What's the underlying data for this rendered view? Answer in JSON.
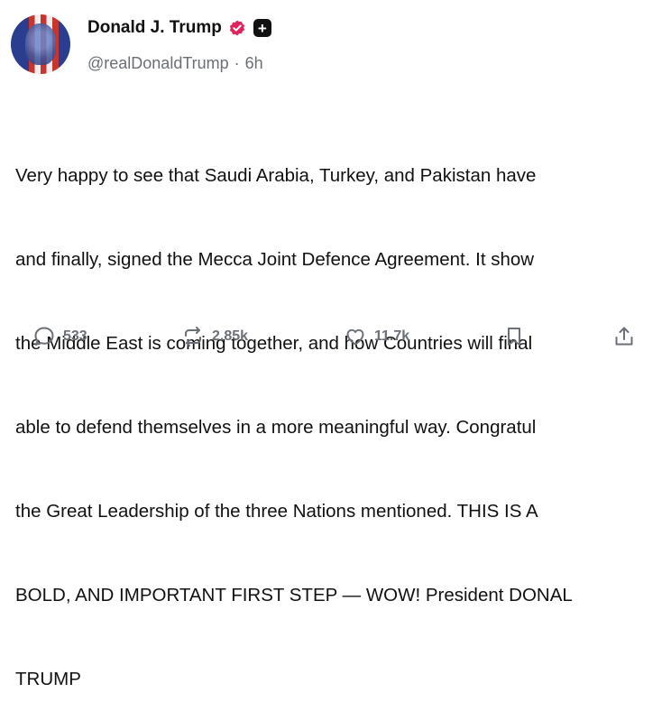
{
  "author": {
    "name": "Donald J. Trump",
    "handle": "@realDonaldTrump",
    "separator": "·",
    "time": "6h"
  },
  "post": {
    "lines": [
      "Very happy to see that Saudi Arabia, Turkey, and Pakistan have",
      "and finally, signed the Mecca Joint Defence Agreement. It show",
      "the Middle East is coming together, and how Countries will final",
      "able to defend themselves in a more meaningful way. Congratul",
      "the Great Leadership of the three Nations mentioned. THIS IS A",
      "BOLD, AND IMPORTANT FIRST STEP — WOW! President DONAL",
      "TRUMP"
    ]
  },
  "actions": {
    "reply_count": "533",
    "repost_count": "2.85k",
    "like_count": "11.7k"
  },
  "colors": {
    "verified_badge": "#e0245e",
    "secondary_text": "#6b6f76"
  },
  "icons": {
    "verified": "verified-badge-icon",
    "follow": "plus-icon",
    "reply": "comment-icon",
    "repost": "repost-icon",
    "like": "heart-icon",
    "bookmark": "bookmark-icon",
    "share": "share-icon"
  }
}
